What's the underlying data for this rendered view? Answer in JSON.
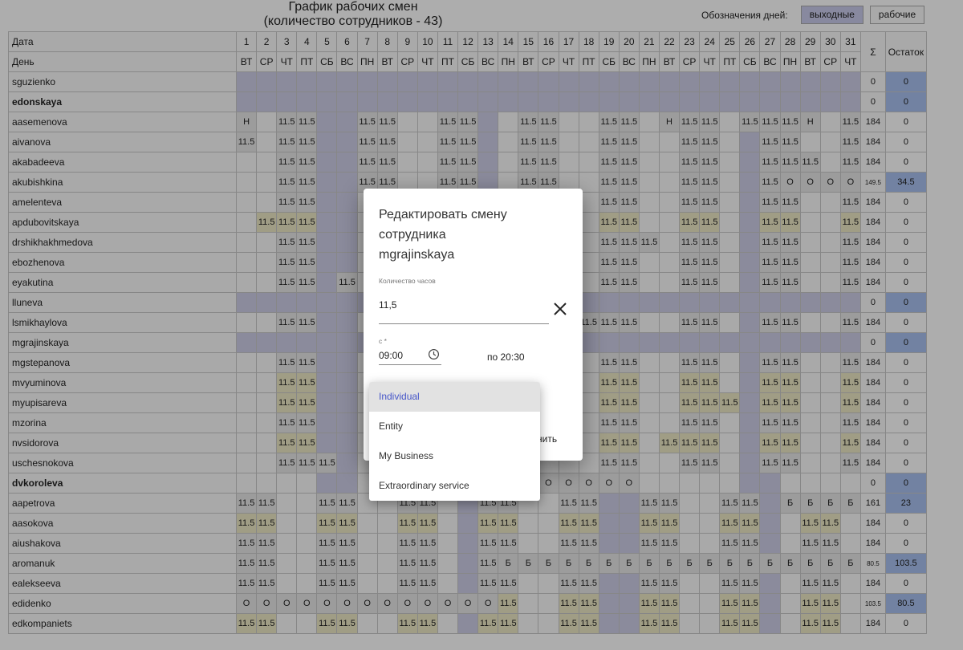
{
  "page": {
    "title_line1": "График рабочих смен",
    "title_line2": "(количество сотрудников - 43)"
  },
  "legend": {
    "label": "Обозначения дней:",
    "weekend": "выходные",
    "workday": "рабочие"
  },
  "table": {
    "label_date": "Дата",
    "label_day": "День",
    "label_sum": "Σ",
    "label_rest": "Остаток",
    "days": [
      "1",
      "2",
      "3",
      "4",
      "5",
      "6",
      "7",
      "8",
      "9",
      "10",
      "11",
      "12",
      "13",
      "14",
      "15",
      "16",
      "17",
      "18",
      "19",
      "20",
      "21",
      "22",
      "23",
      "24",
      "25",
      "26",
      "27",
      "28",
      "29",
      "30",
      "31"
    ],
    "weekdays": [
      "ВТ",
      "СР",
      "ЧТ",
      "ПТ",
      "СБ",
      "ВС",
      "ПН",
      "ВТ",
      "СР",
      "ЧТ",
      "ПТ",
      "СБ",
      "ВС",
      "ПН",
      "ВТ",
      "СР",
      "ЧТ",
      "ПТ",
      "СБ",
      "ВС",
      "ПН",
      "ВТ",
      "СР",
      "ЧТ",
      "ПТ",
      "СБ",
      "ВС",
      "ПН",
      "ВТ",
      "СР",
      "ЧТ"
    ],
    "weekend_days": [
      5,
      6,
      12,
      13,
      19,
      20,
      26,
      27
    ],
    "rows": [
      {
        "name": "sguzienko",
        "bold": false,
        "all_off": true,
        "cells": [],
        "sum": "0",
        "rest": "0",
        "rest_pos": true
      },
      {
        "name": "edonskaya",
        "bold": true,
        "all_off": true,
        "cells": [],
        "sum": "0",
        "rest": "0",
        "rest_pos": true
      },
      {
        "name": "aasemenova",
        "cells": [
          "Н",
          "",
          "11.5",
          "11.5",
          "",
          "",
          "11.5",
          "11.5",
          "",
          "",
          "11.5",
          "11.5",
          "",
          "",
          "11.5",
          "11.5",
          "",
          "",
          "11.5",
          "11.5",
          "",
          "Н",
          "11.5",
          "11.5",
          "",
          "11.5",
          "11.5",
          "11.5",
          "Н",
          "",
          "11.5"
        ],
        "sum": "184",
        "rest": "0"
      },
      {
        "name": "aivanova",
        "cells": [
          "11.5",
          "",
          "11.5",
          "11.5",
          "",
          "",
          "11.5",
          "11.5",
          "",
          "",
          "11.5",
          "11.5",
          "",
          "",
          "11.5",
          "11.5",
          "",
          "",
          "11.5",
          "11.5",
          "",
          "",
          "11.5",
          "11.5",
          "",
          "",
          "11.5",
          "11.5",
          "",
          "",
          "11.5"
        ],
        "sum": "184",
        "rest": "0"
      },
      {
        "name": "akabadeeva",
        "cells": [
          "",
          "",
          "11.5",
          "11.5",
          "",
          "",
          "11.5",
          "11.5",
          "",
          "",
          "11.5",
          "11.5",
          "",
          "",
          "11.5",
          "11.5",
          "",
          "",
          "11.5",
          "11.5",
          "",
          "",
          "11.5",
          "11.5",
          "",
          "",
          "11.5",
          "11.5",
          "11.5",
          "",
          "11.5"
        ],
        "sum": "184",
        "rest": "0"
      },
      {
        "name": "akubishkina",
        "cells": [
          "",
          "",
          "11.5",
          "11.5",
          "",
          "",
          "11.5",
          "11.5",
          "",
          "",
          "11.5",
          "11.5",
          "",
          "",
          "11.5",
          "11.5",
          "",
          "",
          "11.5",
          "11.5",
          "",
          "",
          "11.5",
          "11.5",
          "",
          "",
          "11.5",
          "О",
          "О",
          "О",
          "О"
        ],
        "sum": "149.5",
        "rest": "34.5",
        "rest_pos": true,
        "small_sum": true
      },
      {
        "name": "amelenteva",
        "cells": [
          "",
          "",
          "11.5",
          "11.5",
          "",
          "",
          "",
          "",
          "",
          "",
          "",
          "",
          "",
          "",
          "",
          "",
          "",
          "",
          "11.5",
          "11.5",
          "",
          "",
          "11.5",
          "11.5",
          "",
          "",
          "11.5",
          "11.5",
          "",
          "",
          "11.5"
        ],
        "sum": "184",
        "rest": "0"
      },
      {
        "name": "apdubovitskaya",
        "yellow": true,
        "cells": [
          "",
          "11.5",
          "11.5",
          "11.5",
          "",
          "",
          "",
          "",
          "",
          "",
          "",
          "",
          "",
          "",
          "",
          "",
          "",
          "",
          "11.5",
          "11.5",
          "",
          "",
          "11.5",
          "11.5",
          "",
          "",
          "11.5",
          "11.5",
          "",
          "",
          "11.5"
        ],
        "sum": "184",
        "rest": "0"
      },
      {
        "name": "drshikhakhmedova",
        "cells": [
          "",
          "",
          "11.5",
          "11.5",
          "",
          "",
          "",
          "",
          "",
          "",
          "",
          "",
          "",
          "",
          "",
          "",
          "",
          "",
          "11.5",
          "11.5",
          "11.5",
          "",
          "11.5",
          "11.5",
          "",
          "",
          "11.5",
          "11.5",
          "",
          "",
          "11.5"
        ],
        "sum": "184",
        "rest": "0"
      },
      {
        "name": "ebozhenova",
        "cells": [
          "",
          "",
          "11.5",
          "11.5",
          "",
          "",
          "",
          "",
          "",
          "",
          "",
          "",
          "",
          "",
          "",
          "",
          "",
          "",
          "11.5",
          "11.5",
          "",
          "",
          "11.5",
          "11.5",
          "",
          "",
          "11.5",
          "11.5",
          "",
          "",
          "11.5"
        ],
        "sum": "184",
        "rest": "0"
      },
      {
        "name": "eyakutina",
        "cells": [
          "",
          "",
          "11.5",
          "11.5",
          "",
          "11.5",
          "",
          "",
          "",
          "",
          "",
          "",
          "",
          "",
          "",
          "",
          "",
          "",
          "11.5",
          "11.5",
          "",
          "",
          "11.5",
          "11.5",
          "",
          "",
          "11.5",
          "11.5",
          "",
          "",
          "11.5"
        ],
        "sum": "184",
        "rest": "0"
      },
      {
        "name": "lluneva",
        "bold": false,
        "all_off": true,
        "cells": [],
        "sum": "0",
        "rest": "0",
        "rest_pos": true
      },
      {
        "name": "lsmikhaylova",
        "cells": [
          "",
          "",
          "11.5",
          "11.5",
          "",
          "",
          "",
          "",
          "",
          "",
          "",
          "",
          "",
          "",
          "",
          "",
          "",
          "11.5",
          "11.5",
          "11.5",
          "",
          "",
          "11.5",
          "11.5",
          "",
          "",
          "11.5",
          "11.5",
          "",
          "",
          "11.5"
        ],
        "sum": "184",
        "rest": "0"
      },
      {
        "name": "mgrajinskaya",
        "bold": false,
        "all_off": true,
        "cells": [],
        "sum": "0",
        "rest": "0",
        "rest_pos": true
      },
      {
        "name": "mgstepanova",
        "cells": [
          "",
          "",
          "11.5",
          "11.5",
          "",
          "",
          "",
          "",
          "",
          "",
          "",
          "",
          "",
          "",
          "",
          "",
          "",
          "",
          "11.5",
          "11.5",
          "",
          "",
          "11.5",
          "11.5",
          "",
          "",
          "11.5",
          "11.5",
          "",
          "",
          "11.5"
        ],
        "sum": "184",
        "rest": "0"
      },
      {
        "name": "mvyuminova",
        "yellow": true,
        "cells": [
          "",
          "",
          "11.5",
          "11.5",
          "",
          "",
          "",
          "",
          "",
          "",
          "",
          "",
          "",
          "",
          "",
          "",
          "",
          "",
          "11.5",
          "11.5",
          "",
          "",
          "11.5",
          "11.5",
          "",
          "",
          "11.5",
          "11.5",
          "",
          "",
          "11.5"
        ],
        "sum": "184",
        "rest": "0"
      },
      {
        "name": "myupisareva",
        "yellow": true,
        "cells": [
          "",
          "",
          "11.5",
          "11.5",
          "",
          "",
          "",
          "",
          "",
          "",
          "",
          "",
          "",
          "",
          "",
          "",
          "",
          "",
          "11.5",
          "11.5",
          "",
          "",
          "11.5",
          "11.5",
          "11.5",
          "",
          "11.5",
          "11.5",
          "",
          "",
          "11.5"
        ],
        "sum": "184",
        "rest": "0"
      },
      {
        "name": "mzorina",
        "cells": [
          "",
          "",
          "11.5",
          "11.5",
          "",
          "",
          "",
          "",
          "",
          "",
          "",
          "",
          "",
          "",
          "",
          "",
          "",
          "",
          "11.5",
          "11.5",
          "",
          "",
          "11.5",
          "11.5",
          "",
          "",
          "11.5",
          "11.5",
          "",
          "",
          "11.5"
        ],
        "sum": "184",
        "rest": "0"
      },
      {
        "name": "nvsidorova",
        "yellow": true,
        "cells": [
          "",
          "",
          "11.5",
          "11.5",
          "",
          "",
          "",
          "",
          "",
          "",
          "",
          "",
          "",
          "",
          "",
          "",
          "",
          "",
          "11.5",
          "11.5",
          "",
          "11.5",
          "11.5",
          "11.5",
          "",
          "",
          "11.5",
          "11.5",
          "",
          "",
          "11.5"
        ],
        "sum": "184",
        "rest": "0"
      },
      {
        "name": "uschesnokova",
        "cells": [
          "",
          "",
          "11.5",
          "11.5",
          "11.5",
          "",
          "",
          "",
          "",
          "",
          "",
          "",
          "",
          "",
          "",
          "",
          "",
          "",
          "11.5",
          "11.5",
          "",
          "",
          "11.5",
          "11.5",
          "",
          "",
          "11.5",
          "11.5",
          "",
          "",
          "11.5"
        ],
        "sum": "184",
        "rest": "0"
      },
      {
        "name": "dvkoroleva",
        "bold": true,
        "cells": [
          "",
          "",
          "",
          "",
          "",
          "",
          "",
          "",
          "",
          "",
          "",
          "",
          "",
          "",
          "",
          "О",
          "О",
          "О",
          "О",
          "О",
          "",
          "",
          "",
          "",
          "",
          "",
          "",
          "",
          "",
          "",
          ""
        ],
        "sum": "0",
        "rest": "0",
        "rest_pos": true
      },
      {
        "name": "aapetrova",
        "cells": [
          "11.5",
          "11.5",
          "",
          "",
          "11.5",
          "11.5",
          "",
          "",
          "11.5",
          "11.5",
          "",
          "",
          "11.5",
          "11.5",
          "",
          "",
          "11.5",
          "11.5",
          "",
          "",
          "11.5",
          "11.5",
          "",
          "",
          "11.5",
          "11.5",
          "",
          "Б",
          "Б",
          "Б",
          "Б"
        ],
        "sum": "161",
        "rest": "23",
        "rest_pos": true
      },
      {
        "name": "aasokova",
        "yellow": true,
        "cells": [
          "11.5",
          "11.5",
          "",
          "",
          "11.5",
          "11.5",
          "",
          "",
          "11.5",
          "11.5",
          "",
          "",
          "11.5",
          "11.5",
          "",
          "",
          "11.5",
          "11.5",
          "",
          "",
          "11.5",
          "11.5",
          "",
          "",
          "11.5",
          "11.5",
          "",
          "",
          "11.5",
          "11.5",
          ""
        ],
        "sum": "184",
        "rest": "0"
      },
      {
        "name": "aiushakova",
        "cells": [
          "11.5",
          "11.5",
          "",
          "",
          "11.5",
          "11.5",
          "",
          "",
          "11.5",
          "11.5",
          "",
          "",
          "11.5",
          "11.5",
          "",
          "",
          "11.5",
          "11.5",
          "",
          "",
          "11.5",
          "11.5",
          "",
          "",
          "11.5",
          "11.5",
          "",
          "",
          "11.5",
          "11.5",
          ""
        ],
        "sum": "184",
        "rest": "0"
      },
      {
        "name": "aromanuk",
        "cells": [
          "11.5",
          "11.5",
          "",
          "",
          "11.5",
          "11.5",
          "",
          "",
          "11.5",
          "11.5",
          "",
          "",
          "11.5",
          "Б",
          "Б",
          "Б",
          "Б",
          "Б",
          "Б",
          "Б",
          "Б",
          "Б",
          "Б",
          "Б",
          "Б",
          "Б",
          "Б",
          "Б",
          "Б",
          "Б",
          "Б"
        ],
        "sum": "80.5",
        "rest": "103.5",
        "rest_pos": true,
        "small_sum": true
      },
      {
        "name": "ealekseeva",
        "cells": [
          "11.5",
          "11.5",
          "",
          "",
          "11.5",
          "11.5",
          "",
          "",
          "11.5",
          "11.5",
          "",
          "",
          "11.5",
          "11.5",
          "",
          "",
          "11.5",
          "11.5",
          "",
          "",
          "11.5",
          "11.5",
          "",
          "",
          "11.5",
          "11.5",
          "",
          "",
          "11.5",
          "11.5",
          ""
        ],
        "sum": "184",
        "rest": "0"
      },
      {
        "name": "edidenko",
        "yellow": true,
        "cells": [
          "О",
          "О",
          "О",
          "О",
          "О",
          "О",
          "О",
          "О",
          "О",
          "О",
          "О",
          "О",
          "О",
          "11.5",
          "",
          "",
          "11.5",
          "11.5",
          "",
          "",
          "11.5",
          "11.5",
          "",
          "",
          "11.5",
          "11.5",
          "",
          "",
          "11.5",
          "11.5",
          ""
        ],
        "sum": "103.5",
        "rest": "80.5",
        "rest_pos": true,
        "small_sum": true
      },
      {
        "name": "edkompaniets",
        "yellow": true,
        "cells": [
          "11.5",
          "11.5",
          "",
          "",
          "11.5",
          "11.5",
          "",
          "",
          "11.5",
          "11.5",
          "",
          "",
          "11.5",
          "11.5",
          "",
          "",
          "11.5",
          "11.5",
          "",
          "",
          "11.5",
          "11.5",
          "",
          "",
          "11.5",
          "11.5",
          "",
          "",
          "11.5",
          "11.5",
          ""
        ],
        "sum": "184",
        "rest": "0"
      }
    ]
  },
  "dialog": {
    "title_line1": "Редактировать смену",
    "title_line2": "сотрудника",
    "title_line3": "mgrajinskaya",
    "hours_label": "Количество часов",
    "hours_value": "11,5",
    "from_label": "с *",
    "from_value": "09:00",
    "to_text": "по 20:30",
    "save_partial": "нить"
  },
  "dropdown": {
    "options": [
      "Individual",
      "Entity",
      "My Business",
      "Extraordinary service"
    ],
    "selected": "Individual"
  }
}
